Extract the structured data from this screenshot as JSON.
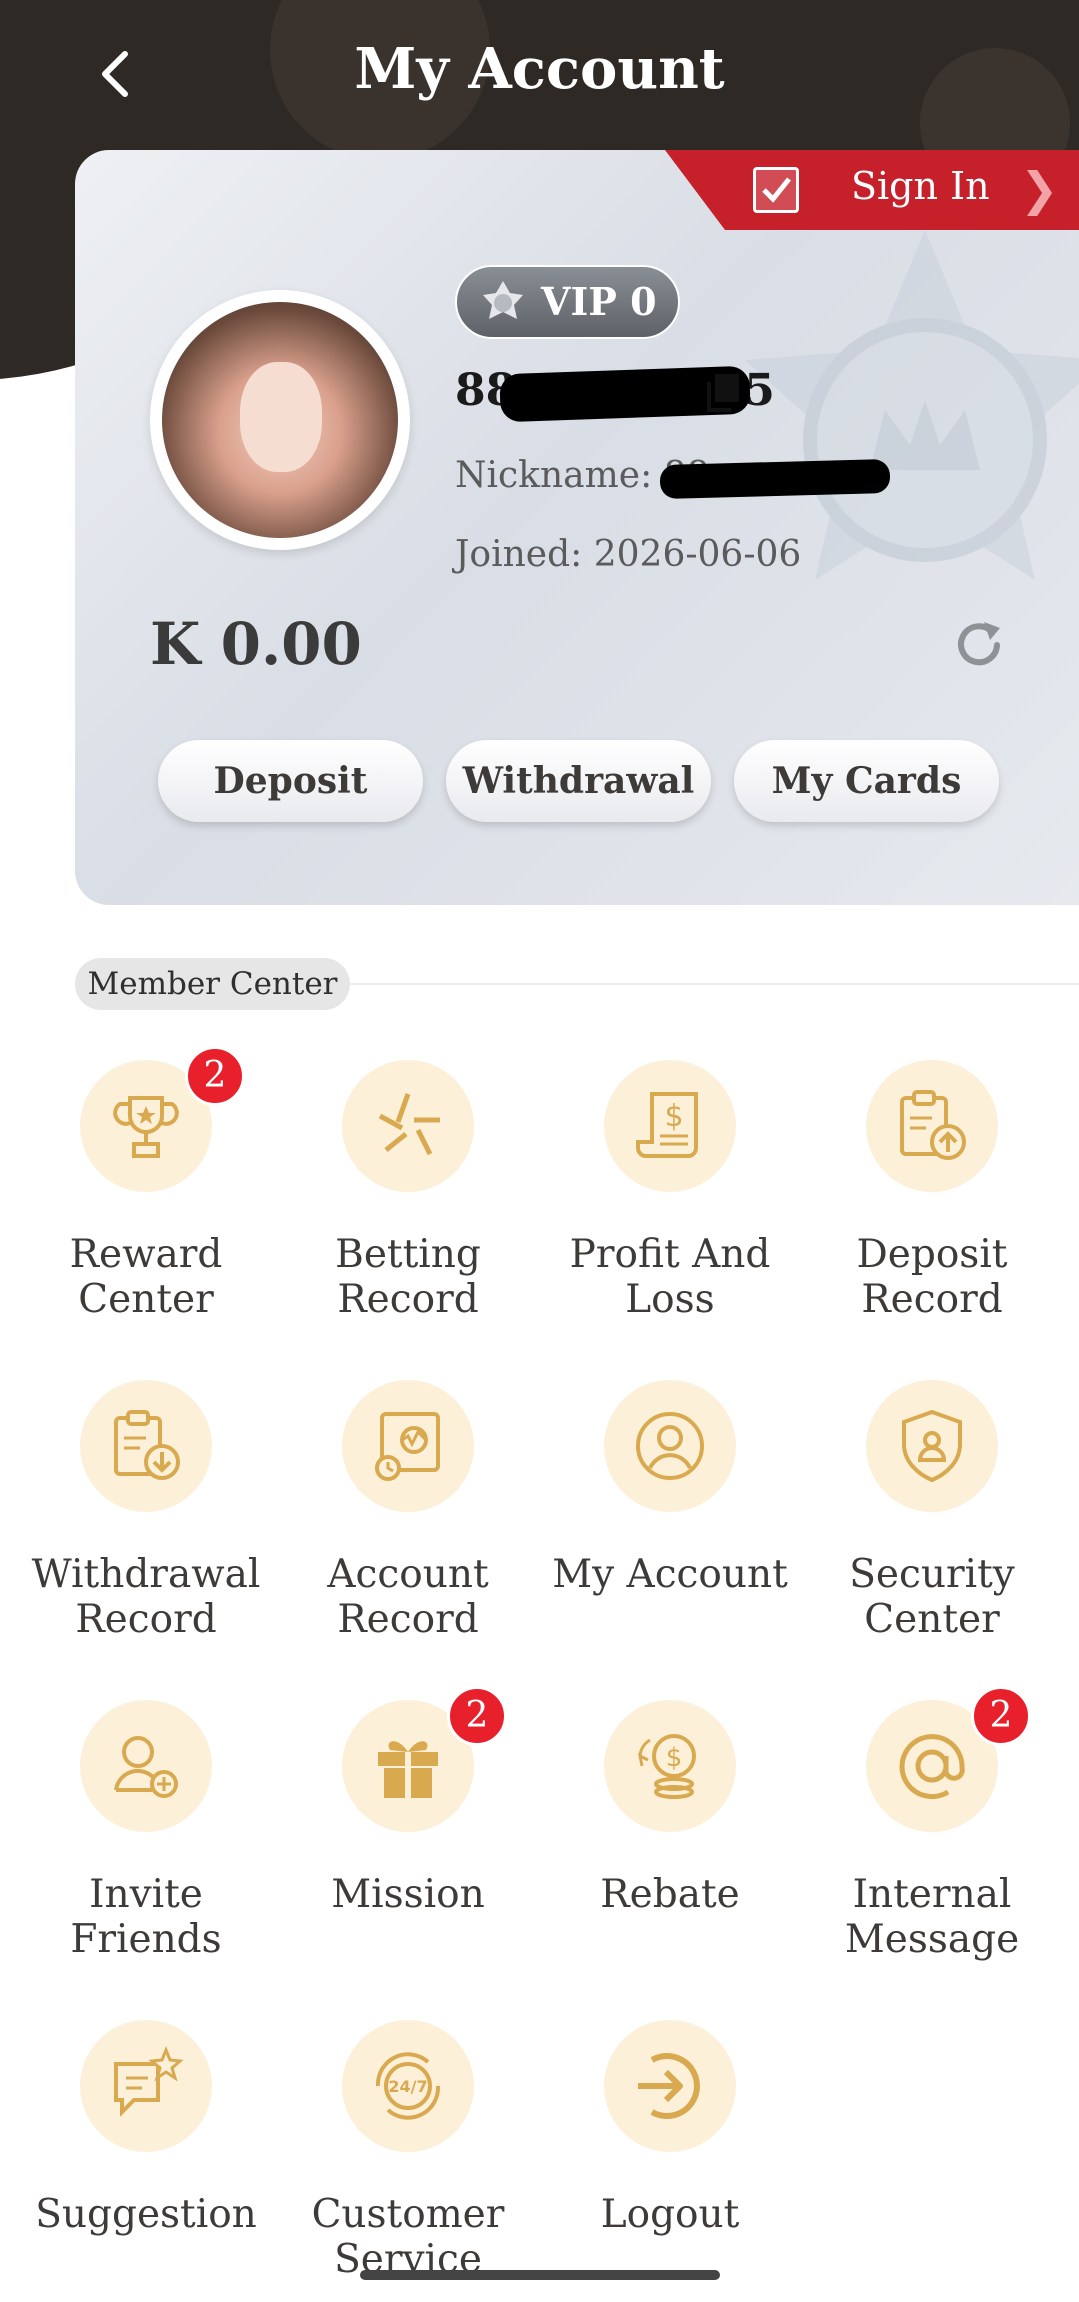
{
  "header": {
    "title": "My Account"
  },
  "card": {
    "signin_label": "Sign In",
    "vip_label": "VIP 0",
    "username_visible": "88",
    "username_tail": "5",
    "nickname_label": "Nickname:",
    "nickname_visible": "88",
    "joined_label": "Joined:",
    "joined_date": "2026-06-06",
    "balance": "K 0.00",
    "buttons": [
      "Deposit",
      "Withdrawal",
      "My Cards"
    ]
  },
  "member_center": {
    "label": "Member Center",
    "items": [
      {
        "label": "Reward\nCenter",
        "icon": "trophy-icon",
        "badge": "2"
      },
      {
        "label": "Betting\nRecord",
        "icon": "betting-icon",
        "badge": ""
      },
      {
        "label": "Profit And\nLoss",
        "icon": "receipt-dollar-icon",
        "badge": ""
      },
      {
        "label": "Deposit\nRecord",
        "icon": "clipboard-upload-icon",
        "badge": ""
      },
      {
        "label": "Withdrawal\nRecord",
        "icon": "clipboard-download-icon",
        "badge": ""
      },
      {
        "label": "Account\nRecord",
        "icon": "account-record-icon",
        "badge": ""
      },
      {
        "label": "My Account",
        "icon": "user-circle-icon",
        "badge": ""
      },
      {
        "label": "Security\nCenter",
        "icon": "shield-user-icon",
        "badge": ""
      },
      {
        "label": "Invite\nFriends",
        "icon": "user-plus-icon",
        "badge": ""
      },
      {
        "label": "Mission",
        "icon": "gift-icon",
        "badge": "2"
      },
      {
        "label": "Rebate",
        "icon": "coins-icon",
        "badge": ""
      },
      {
        "label": "Internal\nMessage",
        "icon": "at-sign-icon",
        "badge": "2"
      },
      {
        "label": "Suggestion",
        "icon": "chat-star-icon",
        "badge": ""
      },
      {
        "label": "Customer\nService",
        "icon": "support-24-7-icon",
        "badge": ""
      },
      {
        "label": "Logout",
        "icon": "logout-icon",
        "badge": ""
      }
    ]
  },
  "colors": {
    "header_dark": "#2f2926",
    "signin_red": "#c6202a",
    "icon_gold": "#d9a94f",
    "icon_bg": "#fdf0d8",
    "badge_red": "#e8202c"
  }
}
